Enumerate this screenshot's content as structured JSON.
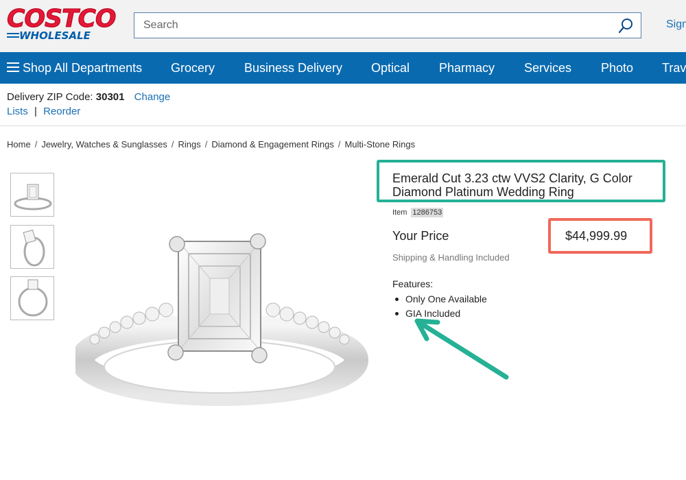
{
  "header": {
    "logo_top": "COSTCO",
    "logo_bottom": "WHOLESALE",
    "search_placeholder": "Search",
    "search_icon": "search-icon",
    "signin_label": "Sign"
  },
  "nav": {
    "items": [
      {
        "label": "Shop All Departments",
        "icon": "hamburger-icon"
      },
      {
        "label": "Grocery"
      },
      {
        "label": "Business Delivery"
      },
      {
        "label": "Optical"
      },
      {
        "label": "Pharmacy"
      },
      {
        "label": "Services"
      },
      {
        "label": "Photo"
      },
      {
        "label": "Trav"
      }
    ]
  },
  "delivery": {
    "zip_label": "Delivery ZIP Code:",
    "zip_value": "30301",
    "change_label": "Change",
    "lists_label": "Lists",
    "separator": "|",
    "reorder_label": "Reorder"
  },
  "breadcrumb": {
    "items": [
      "Home",
      "Jewelry, Watches & Sunglasses",
      "Rings",
      "Diamond & Engagement Rings",
      "Multi-Stone Rings"
    ],
    "separator": "/"
  },
  "thumbnails": [
    {
      "icon": "ring-front-thumbnail"
    },
    {
      "icon": "ring-side-thumbnail"
    },
    {
      "icon": "ring-top-thumbnail"
    }
  ],
  "product": {
    "title": "Emerald Cut 3.23 ctw VVS2 Clarity, G Color Diamond Platinum Wedding Ring",
    "item_label": "Item",
    "item_number": "1286753",
    "price_label": "Your Price",
    "price": "$44,999.99",
    "shipping": "Shipping & Handling Included",
    "features_title": "Features:",
    "features": [
      "Only One Available",
      "GIA Included"
    ]
  },
  "annotations": {
    "title_box_color": "#25b195",
    "price_box_color": "#f0685a",
    "arrow_color": "#25b195"
  },
  "colors": {
    "brand_red": "#e31837",
    "brand_blue": "#005daa",
    "nav_blue": "#0a6ab0",
    "link_blue": "#1a6fb3"
  }
}
